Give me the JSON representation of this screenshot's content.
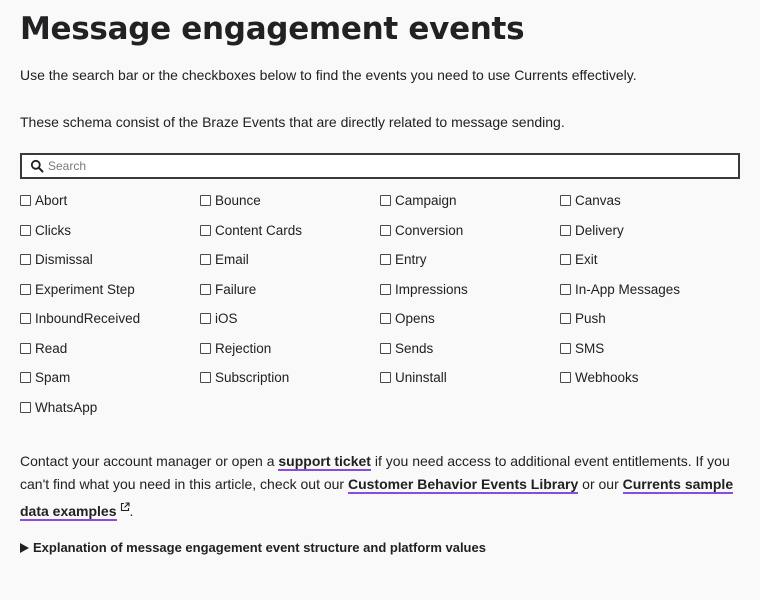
{
  "page_title": "Message engagement events",
  "intro_1": "Use the search bar or the checkboxes below to find the events you need to use Currents effectively.",
  "intro_2": "These schema consist of the Braze Events that are directly related to message sending.",
  "search": {
    "placeholder": "Search",
    "value": ""
  },
  "checkboxes": {
    "abort": {
      "label": "Abort",
      "checked": false
    },
    "bounce": {
      "label": "Bounce",
      "checked": false
    },
    "campaign": {
      "label": "Campaign",
      "checked": false
    },
    "canvas": {
      "label": "Canvas",
      "checked": false
    },
    "clicks": {
      "label": "Clicks",
      "checked": false
    },
    "content_cards": {
      "label": "Content Cards",
      "checked": false
    },
    "conversion": {
      "label": "Conversion",
      "checked": false
    },
    "delivery": {
      "label": "Delivery",
      "checked": false
    },
    "dismissal": {
      "label": "Dismissal",
      "checked": false
    },
    "email": {
      "label": "Email",
      "checked": false
    },
    "entry": {
      "label": "Entry",
      "checked": false
    },
    "exit": {
      "label": "Exit",
      "checked": false
    },
    "experiment_step": {
      "label": "Experiment Step",
      "checked": false
    },
    "failure": {
      "label": "Failure",
      "checked": false
    },
    "impressions": {
      "label": "Impressions",
      "checked": false
    },
    "in_app_messages": {
      "label": "In-App Messages",
      "checked": false
    },
    "inbound_received": {
      "label": "InboundReceived",
      "checked": false
    },
    "ios": {
      "label": "iOS",
      "checked": false
    },
    "opens": {
      "label": "Opens",
      "checked": false
    },
    "push": {
      "label": "Push",
      "checked": false
    },
    "read": {
      "label": "Read",
      "checked": false
    },
    "rejection": {
      "label": "Rejection",
      "checked": false
    },
    "sends": {
      "label": "Sends",
      "checked": false
    },
    "sms": {
      "label": "SMS",
      "checked": false
    },
    "spam": {
      "label": "Spam",
      "checked": false
    },
    "subscription": {
      "label": "Subscription",
      "checked": false
    },
    "uninstall": {
      "label": "Uninstall",
      "checked": false
    },
    "webhooks": {
      "label": "Webhooks",
      "checked": false
    },
    "whatsapp": {
      "label": "WhatsApp",
      "checked": false
    }
  },
  "contact": {
    "text_1": "Contact your account manager or open a ",
    "link_support": "support ticket",
    "text_2": " if you need access to additional event entitlements. If you can't find what you need in this article, check out our ",
    "link_library": "Customer Behavior Events Library",
    "text_3": " or our ",
    "link_examples": "Currents sample data examples",
    "text_4": "."
  },
  "details_summary": "Explanation of message engagement event structure and platform values",
  "icons": {
    "search": "search-icon",
    "external_link": "external-link-icon",
    "disclosure": "disclosure-triangle-icon"
  },
  "colors": {
    "link_underline": "#8a4be0",
    "text": "#212123",
    "background": "#f9f9f9"
  }
}
